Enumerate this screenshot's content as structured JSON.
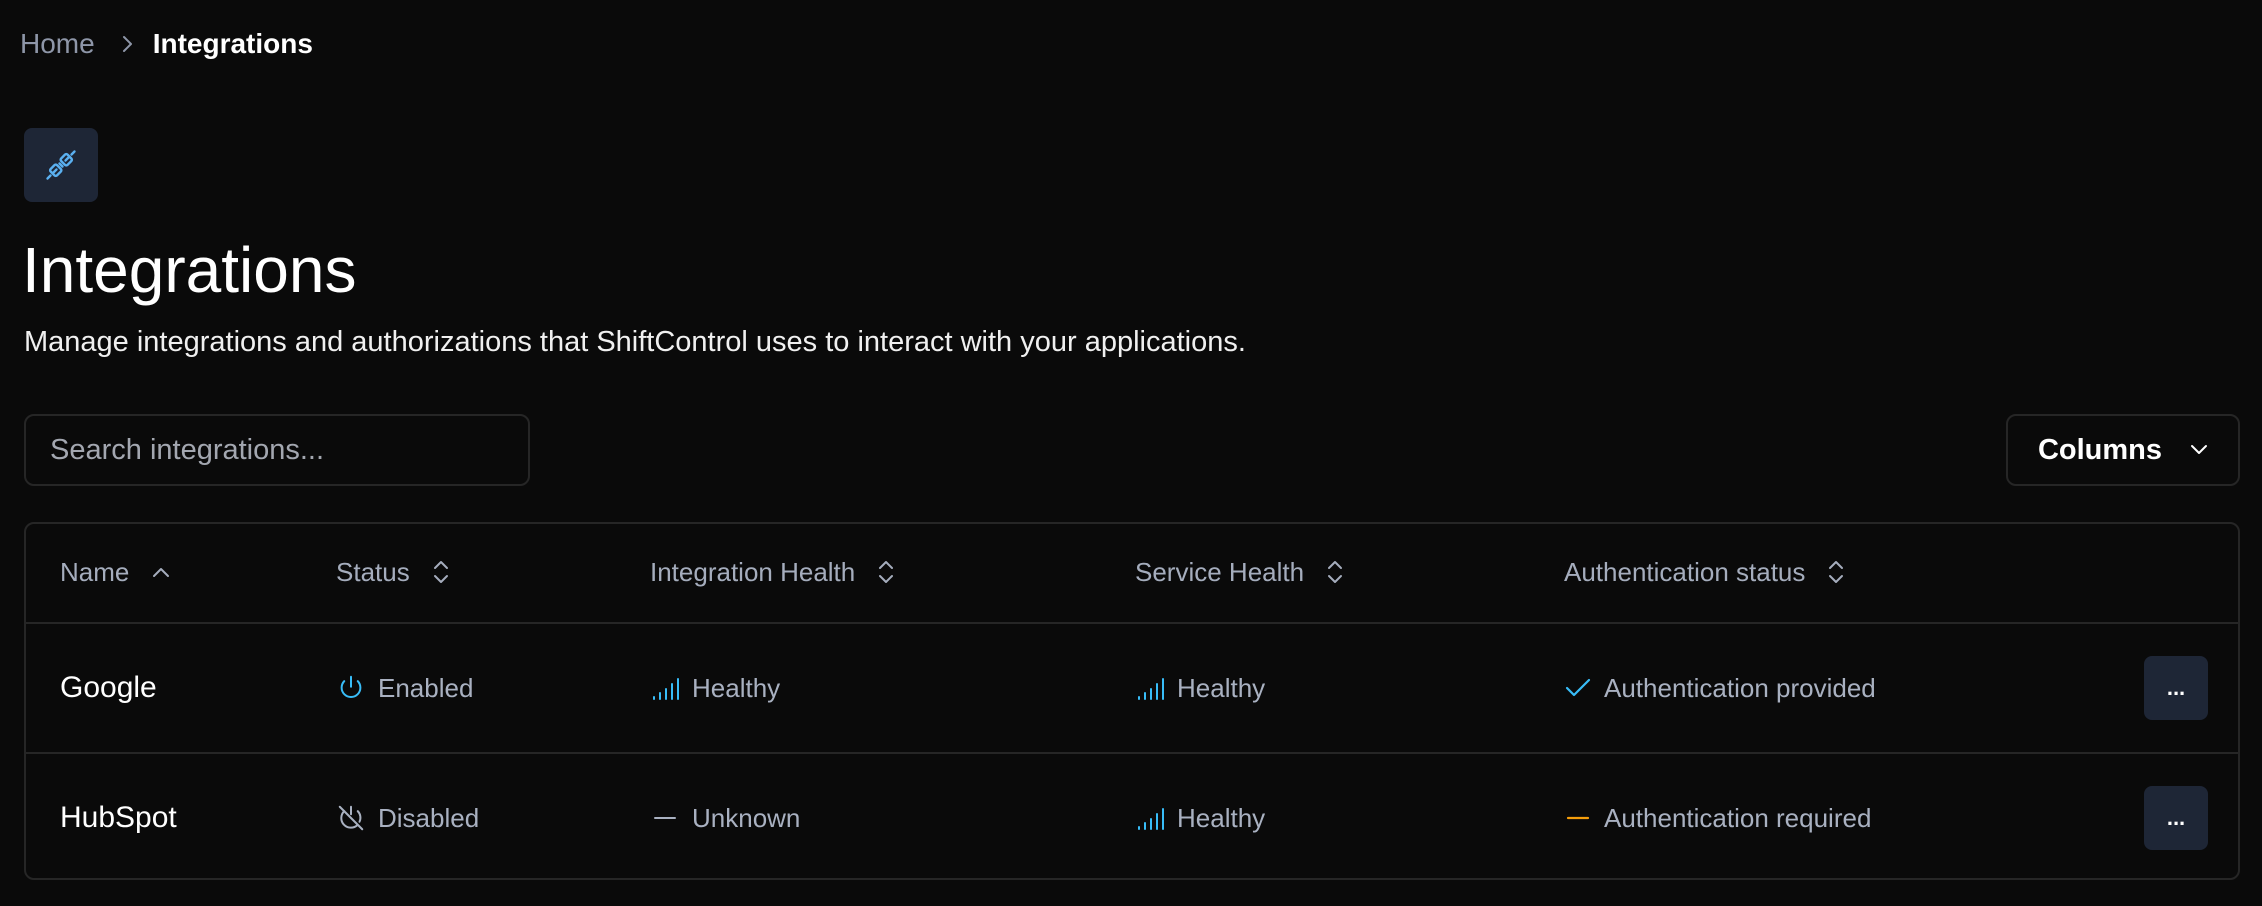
{
  "breadcrumb": {
    "home": "Home",
    "current": "Integrations"
  },
  "page": {
    "title": "Integrations",
    "description": "Manage integrations and authorizations that ShiftControl uses to interact with your applications.",
    "icon": "plug-icon"
  },
  "search": {
    "placeholder": "Search integrations...",
    "value": ""
  },
  "columns_button": {
    "label": "Columns"
  },
  "table": {
    "headers": {
      "name": "Name",
      "status": "Status",
      "integration_health": "Integration Health",
      "service_health": "Service Health",
      "auth_status": "Authentication status"
    },
    "rows": [
      {
        "name": "Google",
        "status": "Enabled",
        "status_icon": "power-icon",
        "integration_health": "Healthy",
        "integration_health_icon": "signal-bars-icon",
        "service_health": "Healthy",
        "service_health_icon": "signal-bars-icon",
        "auth_status": "Authentication provided",
        "auth_icon": "check-icon",
        "actions_label": "..."
      },
      {
        "name": "HubSpot",
        "status": "Disabled",
        "status_icon": "power-off-icon",
        "integration_health": "Unknown",
        "integration_health_icon": "dash-icon",
        "service_health": "Healthy",
        "service_health_icon": "signal-bars-icon",
        "auth_status": "Authentication required",
        "auth_icon": "dash-icon",
        "actions_label": "..."
      }
    ]
  },
  "colors": {
    "background": "#0a0a0a",
    "border": "#262626",
    "accent_blue": "#38bdf8",
    "warning_orange": "#f59e0b",
    "muted_text": "#a9b1c1",
    "icon_tile": "#1e2636"
  }
}
